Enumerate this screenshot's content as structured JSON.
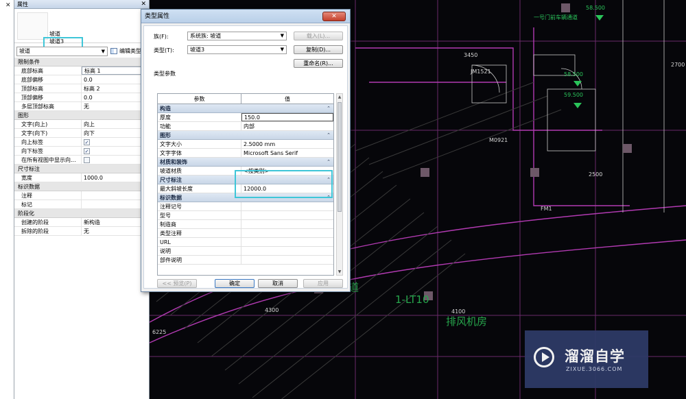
{
  "gutter": {
    "close_glyph": "✕"
  },
  "props_panel": {
    "title": "属性",
    "close_glyph": "✕",
    "family_name": "坡道",
    "type_name": "坡道3",
    "selector_value": "坡道",
    "edit_type_label": "编辑类型",
    "groups": [
      {
        "name": "限制条件",
        "rows": [
          {
            "key": "底部标高",
            "value": "标高 1",
            "boxed": true
          },
          {
            "key": "底部偏移",
            "value": "0.0"
          },
          {
            "key": "顶部标高",
            "value": "标高 2"
          },
          {
            "key": "顶部偏移",
            "value": "0.0"
          },
          {
            "key": "多层顶部标高",
            "value": "无"
          }
        ]
      },
      {
        "name": "图形",
        "rows": [
          {
            "key": "文字(向上)",
            "value": "向上"
          },
          {
            "key": "文字(向下)",
            "value": "向下"
          },
          {
            "key": "向上标签",
            "check": true
          },
          {
            "key": "向下标签",
            "check": true
          },
          {
            "key": "在所有视图中显示向...",
            "check": false
          }
        ]
      },
      {
        "name": "尺寸标注",
        "rows": [
          {
            "key": "宽度",
            "value": "1000.0"
          }
        ]
      },
      {
        "name": "标识数据",
        "rows": [
          {
            "key": "注释",
            "value": ""
          },
          {
            "key": "标记",
            "value": ""
          }
        ]
      },
      {
        "name": "阶段化",
        "rows": [
          {
            "key": "创建的阶段",
            "value": "新构造"
          },
          {
            "key": "拆除的阶段",
            "value": "无"
          }
        ]
      }
    ]
  },
  "dialog": {
    "title": "类型属性",
    "close_glyph": "✕",
    "family_label": "族(F):",
    "family_value": "系统族: 坡道",
    "type_label": "类型(T):",
    "type_value": "坡道3",
    "load_button": "载入(L)...",
    "duplicate_button": "复制(D)...",
    "rename_button": "重命名(R)...",
    "type_params_label": "类型参数",
    "col_param": "参数",
    "col_value": "值",
    "groups": [
      {
        "name": "构造",
        "rows": [
          {
            "key": "厚度",
            "value": "150.0",
            "boxed": true
          },
          {
            "key": "功能",
            "value": "内部"
          }
        ]
      },
      {
        "name": "图形",
        "rows": [
          {
            "key": "文字大小",
            "value": "2.5000 mm"
          },
          {
            "key": "文字字体",
            "value": "Microsoft Sans Serif"
          }
        ]
      },
      {
        "name": "材质和装饰",
        "rows": [
          {
            "key": "坡道材质",
            "value": "<按类别>"
          }
        ]
      },
      {
        "name": "尺寸标注",
        "rows": [
          {
            "key": "最大斜坡长度",
            "value": "12000.0"
          }
        ]
      },
      {
        "name": "标识数据",
        "rows": [
          {
            "key": "注释记号",
            "value": ""
          },
          {
            "key": "型号",
            "value": ""
          },
          {
            "key": "制造商",
            "value": ""
          },
          {
            "key": "类型注释",
            "value": ""
          },
          {
            "key": "URL",
            "value": ""
          },
          {
            "key": "说明",
            "value": ""
          },
          {
            "key": "部件说明",
            "value": ""
          }
        ]
      }
    ],
    "preview_button": "<< 预览(P)",
    "ok_button": "确定",
    "cancel_button": "取消",
    "apply_button": "应用"
  },
  "canvas": {
    "labels": {
      "elev1": "58.500",
      "elev2": "58.500",
      "elev3": "59.500",
      "dim1": "3450",
      "dim2": "4300",
      "dim3": "4100",
      "dim4": "2700",
      "dim5": "6225",
      "dim6": "2500",
      "tag1": "M0921",
      "tag2": "JM1521",
      "tag3": "FM1",
      "ramp": "车道",
      "stair": "1-LT10",
      "room": "排风机房",
      "note": "一号门前车辆通道"
    }
  },
  "watermark": {
    "brand": "溜溜自学",
    "url": "ZIXUE.3066.COM"
  }
}
